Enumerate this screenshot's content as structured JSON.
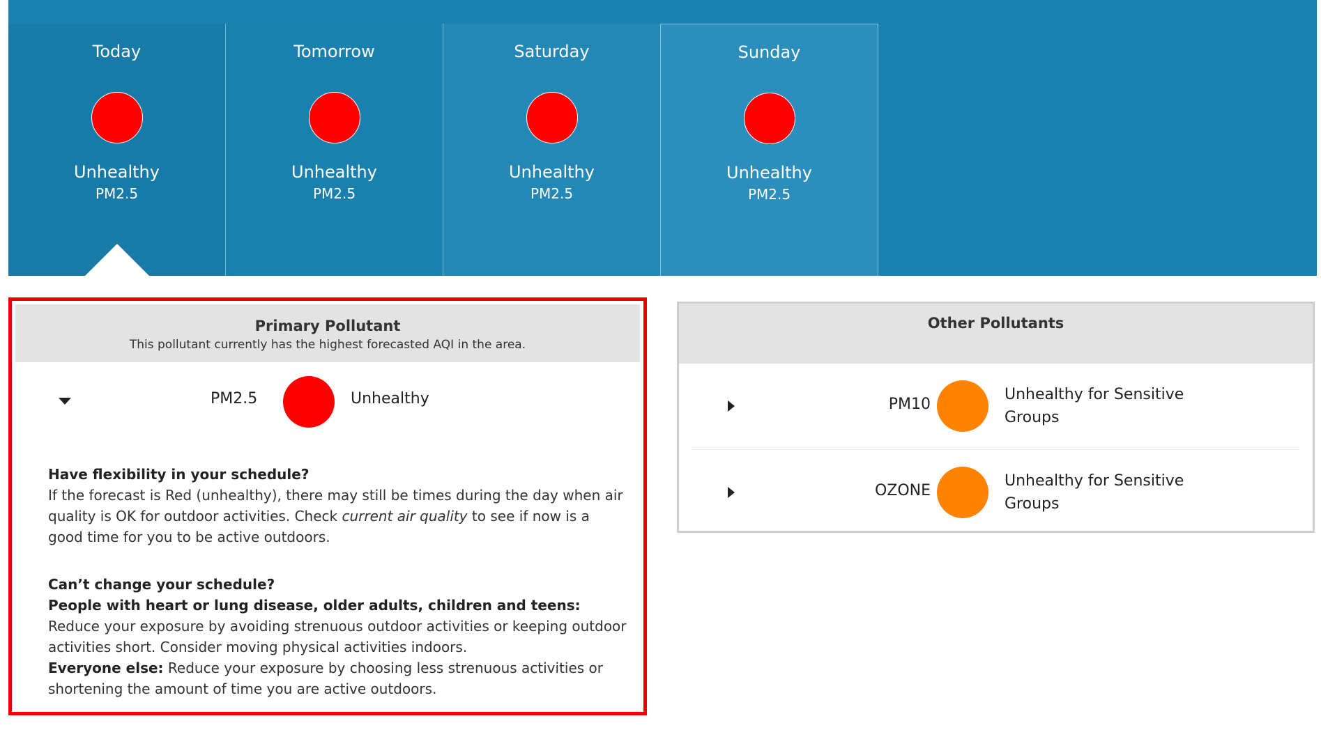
{
  "forecast": {
    "days": [
      {
        "name": "Today",
        "category": "Unhealthy",
        "pollutant": "PM2.5"
      },
      {
        "name": "Tomorrow",
        "category": "Unhealthy",
        "pollutant": "PM2.5"
      },
      {
        "name": "Saturday",
        "category": "Unhealthy",
        "pollutant": "PM2.5"
      },
      {
        "name": "Sunday",
        "category": "Unhealthy",
        "pollutant": "PM2.5"
      }
    ],
    "selected_index": 0
  },
  "primary": {
    "title": "Primary Pollutant",
    "subtitle": "This pollutant currently has the highest forecasted AQI in the area.",
    "pollutant": "PM2.5",
    "category": "Unhealthy",
    "advice": {
      "flex_heading": "Have flexibility in your schedule?",
      "flex_text_1": "If the forecast is Red (unhealthy), there may still be times during the day when air quality is OK for outdoor activities. Check ",
      "flex_link": "current air quality",
      "flex_text_2": " to see if now is a good time for you to be active outdoors.",
      "nochange_heading": "Can’t change your schedule?",
      "sensitive_label": "People with heart or lung disease, older adults, children and teens:",
      "sensitive_text": " Reduce your exposure by avoiding strenuous outdoor activities or keeping outdoor activities short. Consider moving physical activities indoors.",
      "everyone_label": "Everyone else:",
      "everyone_text": " Reduce your exposure by choosing less strenuous activities or shortening the amount of time you are active outdoors."
    }
  },
  "other": {
    "title": "Other Pollutants",
    "items": [
      {
        "pollutant": "PM10",
        "category": "Unhealthy for Sensitive Groups"
      },
      {
        "pollutant": "OZONE",
        "category": "Unhealthy for Sensitive Groups"
      }
    ]
  },
  "colors": {
    "banner": "#1a82b1",
    "unhealthy": "#ff0000",
    "usg": "#ff8200",
    "highlight_border": "#ee0000"
  },
  "icons": {
    "expanded": "caret-down-icon",
    "collapsed": "caret-right-icon"
  }
}
